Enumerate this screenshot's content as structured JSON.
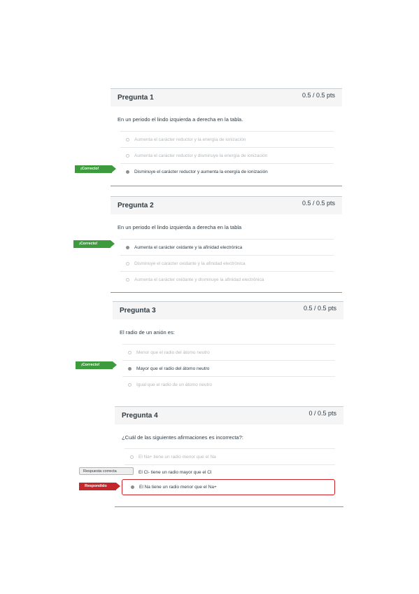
{
  "questions": [
    {
      "title": "Pregunta 1",
      "points": "0.5 / 0.5 pts",
      "text": "En un periodo el lindo izquierda a derecha en la tabla.",
      "answers": [
        "Aumenta el carácter reductor y la energía de ionización",
        "Aumenta el carácter reductor y disminuye la energía de ionización",
        "Disminuye el carácter reductor y aumenta la energía de ionización"
      ],
      "tag": "¡Correcto!"
    },
    {
      "title": "Pregunta 2",
      "points": "0.5 / 0.5 pts",
      "text": "En un periodo el lindo izquierda a derecha en la tabla",
      "answers": [
        "Aumenta el carácter oxidante y la afinidad electrónica",
        "Disminuye el carácter oxidante y la afinidad electrónica",
        "Aumenta el carácter oxidante y disminuye la afinidad electrónica"
      ],
      "tag": "¡Correcto!"
    },
    {
      "title": "Pregunta 3",
      "points": "0.5 / 0.5 pts",
      "text": "El radio de un anión es:",
      "answers": [
        "Menor que el radio del átomo neutro",
        "Mayor que el radio del átomo neutro",
        "Igual que el radio de un átomo neutro"
      ],
      "tag": "¡Correcto!"
    },
    {
      "title": "Pregunta 4",
      "points": "0 / 0.5 pts",
      "text": "¿Cuál de las siguientes afirmaciones es incorrecta?:",
      "answers": [
        "El Na+ tiene un radio menor que el Na",
        "El Cl- tiene un radio mayor que el Cl",
        "El Na tiene un radio menor que el Na+"
      ],
      "tag_correct_answer": "Respuesta correcta",
      "tag_answered": "Respondido"
    }
  ],
  "colors": {
    "correct": "#3d9a3d",
    "answered": "#c4262c",
    "header_bg": "#f5f5f5"
  }
}
